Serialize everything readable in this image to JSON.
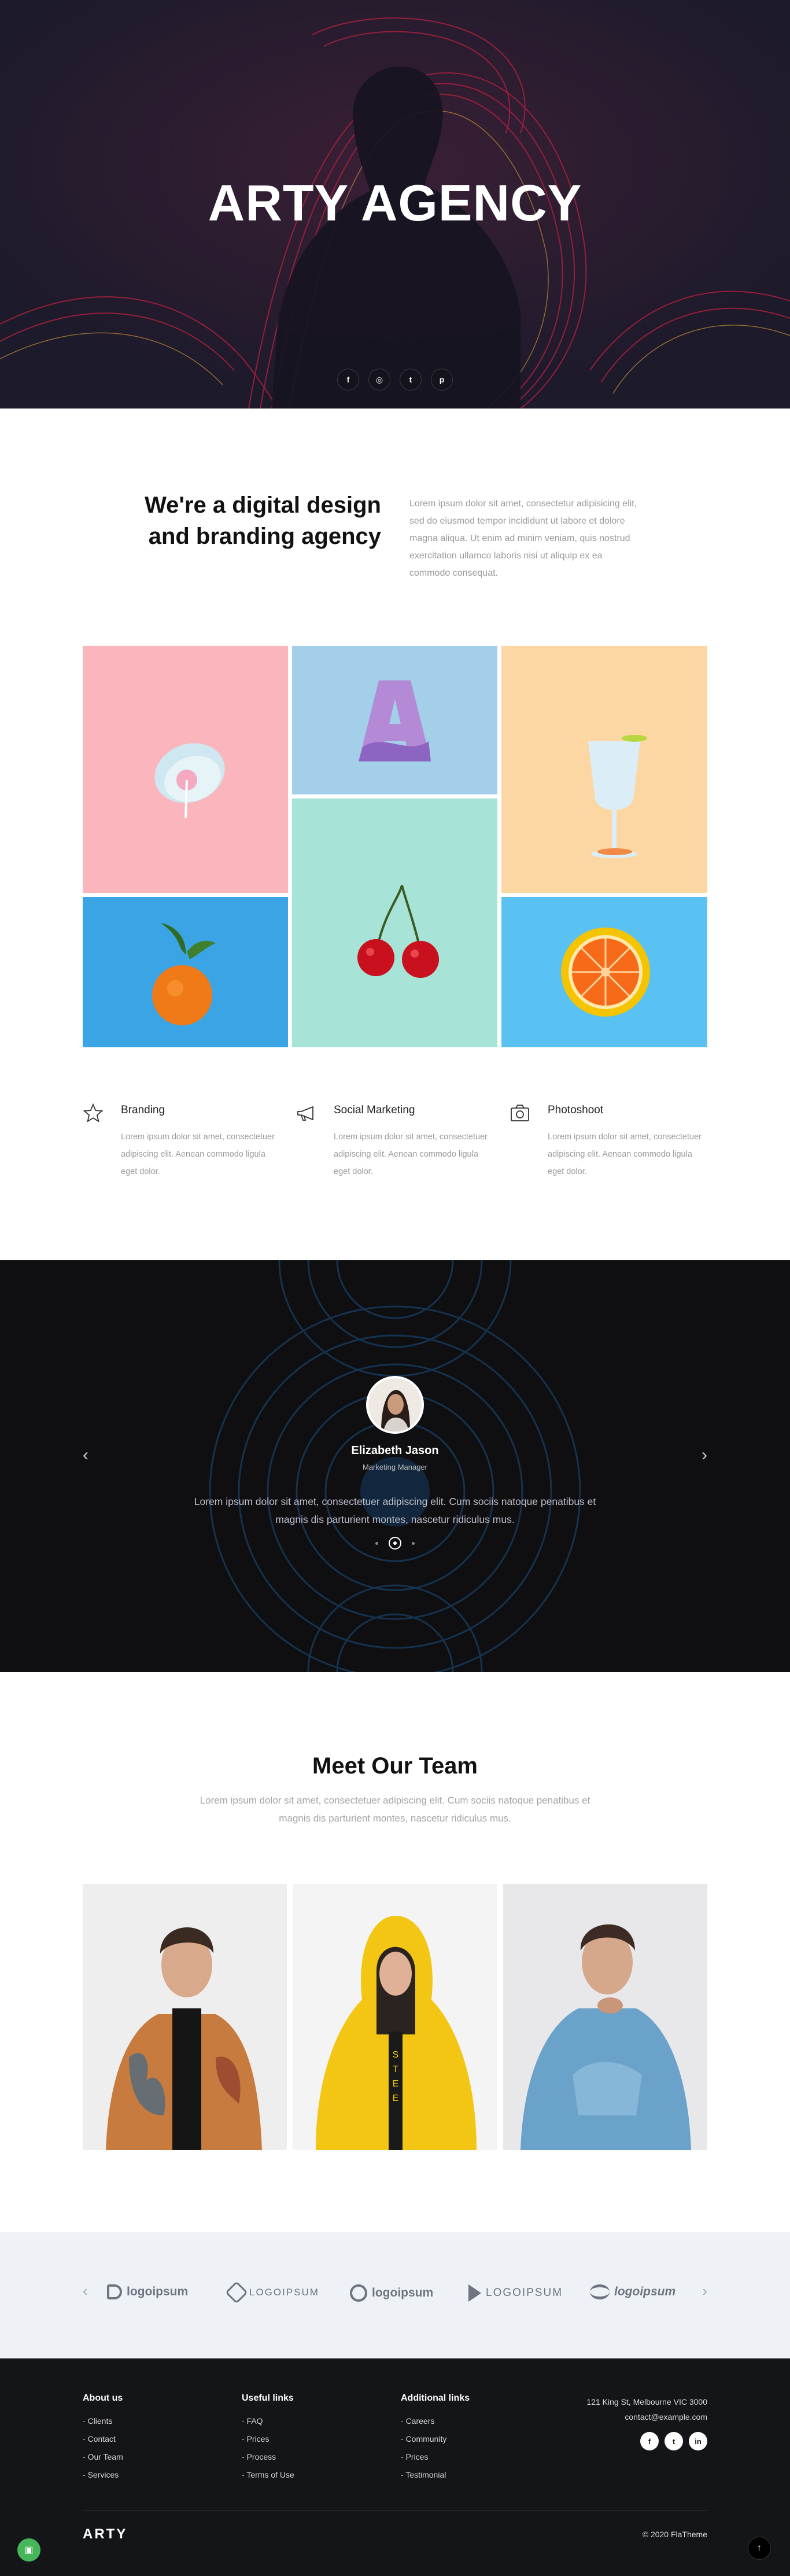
{
  "hero": {
    "title": "ARTY AGENCY",
    "social": [
      {
        "icon": "facebook-icon",
        "glyph": "f"
      },
      {
        "icon": "instagram-icon",
        "glyph": "◎"
      },
      {
        "icon": "twitter-icon",
        "glyph": "t"
      },
      {
        "icon": "pinterest-icon",
        "glyph": "p"
      }
    ]
  },
  "intro": {
    "heading": "We're a digital design and branding agency",
    "text": "Lorem ipsum dolor sit amet, consectetur adipisicing elit, sed do eiusmod tempor incididunt ut labore et dolore magna aliqua. Ut enim ad minim veniam, quis nostrud exercitation ullamco laboris nisi ut aliquip ex ea commodo consequat."
  },
  "services": [
    {
      "icon": "star-icon",
      "title": "Branding",
      "text": "Lorem ipsum dolor sit amet, consectetuer adipiscing elit. Aenean commodo ligula eget dolor."
    },
    {
      "icon": "megaphone-icon",
      "title": "Social Marketing",
      "text": "Lorem ipsum dolor sit amet, consectetuer adipiscing elit. Aenean commodo ligula eget dolor."
    },
    {
      "icon": "camera-icon",
      "title": "Photoshoot",
      "text": "Lorem ipsum dolor sit amet, consectetuer adipiscing elit. Aenean commodo ligula eget dolor."
    }
  ],
  "testimonial": {
    "name": "Elizabeth Jason",
    "role": "Marketing Manager",
    "quote": "Lorem ipsum dolor sit amet, consectetuer adipiscing elit. Cum sociis natoque penatibus et magnis dis parturient montes, nascetur ridiculus mus.",
    "prev": "‹",
    "next": "›"
  },
  "team": {
    "title": "Meet Our Team",
    "subtitle": "Lorem ipsum dolor sit amet, consectetuer adipiscing elit. Cum sociis natoque penatibus et magnis dis parturient montes, nascetur ridiculus mus."
  },
  "logos": {
    "items": [
      "logoipsum",
      "LOGOIPSUM",
      "logoipsum",
      "LOGOIPSUM",
      "logoipsum"
    ],
    "prev": "‹",
    "next": "›"
  },
  "footer": {
    "columns": [
      {
        "heading": "About us",
        "links": [
          "Clients",
          "Contact",
          "Our Team",
          "Services"
        ]
      },
      {
        "heading": "Useful links",
        "links": [
          "FAQ",
          "Prices",
          "Process",
          "Terms of Use"
        ]
      },
      {
        "heading": "Additional links",
        "links": [
          "Careers",
          "Community",
          "Prices",
          "Testimonial"
        ]
      }
    ],
    "address": "121 King St, Melbourne VIC 3000",
    "email": "contact@example.com",
    "social": [
      {
        "icon": "facebook-icon",
        "glyph": "f"
      },
      {
        "icon": "twitter-icon",
        "glyph": "t"
      },
      {
        "icon": "linkedin-icon",
        "glyph": "in"
      }
    ],
    "logo": "ARTY",
    "copyright": "© 2020 FlaTheme"
  }
}
